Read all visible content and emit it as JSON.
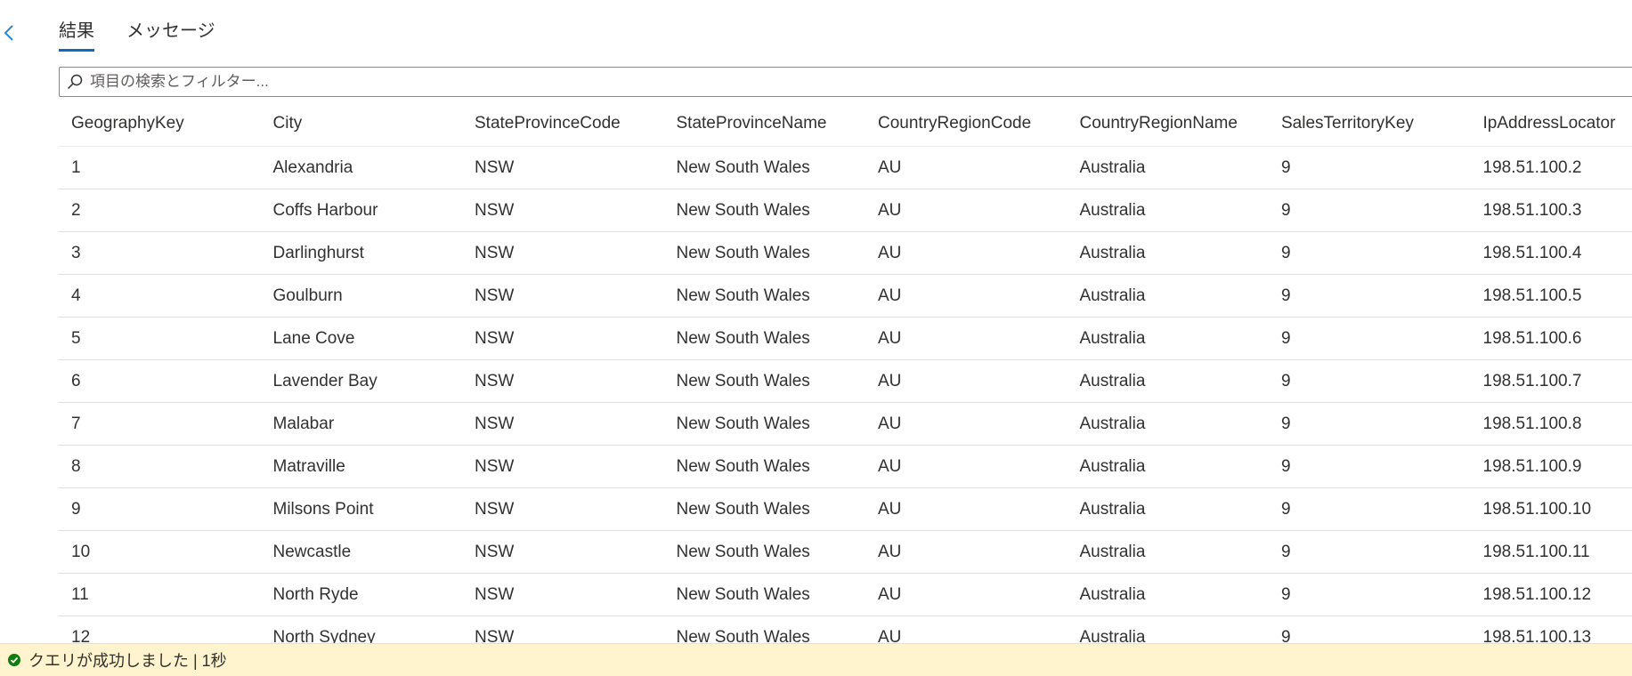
{
  "tabs": [
    {
      "label": "結果",
      "active": true
    },
    {
      "label": "メッセージ",
      "active": false
    }
  ],
  "search": {
    "placeholder": "項目の検索とフィルター...",
    "value": ""
  },
  "table": {
    "columns": [
      "GeographyKey",
      "City",
      "StateProvinceCode",
      "StateProvinceName",
      "CountryRegionCode",
      "CountryRegionName",
      "SalesTerritoryKey",
      "IpAddressLocator"
    ],
    "rows": [
      [
        "1",
        "Alexandria",
        "NSW",
        "New South Wales",
        "AU",
        "Australia",
        "9",
        "198.51.100.2"
      ],
      [
        "2",
        "Coffs Harbour",
        "NSW",
        "New South Wales",
        "AU",
        "Australia",
        "9",
        "198.51.100.3"
      ],
      [
        "3",
        "Darlinghurst",
        "NSW",
        "New South Wales",
        "AU",
        "Australia",
        "9",
        "198.51.100.4"
      ],
      [
        "4",
        "Goulburn",
        "NSW",
        "New South Wales",
        "AU",
        "Australia",
        "9",
        "198.51.100.5"
      ],
      [
        "5",
        "Lane Cove",
        "NSW",
        "New South Wales",
        "AU",
        "Australia",
        "9",
        "198.51.100.6"
      ],
      [
        "6",
        "Lavender Bay",
        "NSW",
        "New South Wales",
        "AU",
        "Australia",
        "9",
        "198.51.100.7"
      ],
      [
        "7",
        "Malabar",
        "NSW",
        "New South Wales",
        "AU",
        "Australia",
        "9",
        "198.51.100.8"
      ],
      [
        "8",
        "Matraville",
        "NSW",
        "New South Wales",
        "AU",
        "Australia",
        "9",
        "198.51.100.9"
      ],
      [
        "9",
        "Milsons Point",
        "NSW",
        "New South Wales",
        "AU",
        "Australia",
        "9",
        "198.51.100.10"
      ],
      [
        "10",
        "Newcastle",
        "NSW",
        "New South Wales",
        "AU",
        "Australia",
        "9",
        "198.51.100.11"
      ],
      [
        "11",
        "North Ryde",
        "NSW",
        "New South Wales",
        "AU",
        "Australia",
        "9",
        "198.51.100.12"
      ],
      [
        "12",
        "North Sydney",
        "NSW",
        "New South Wales",
        "AU",
        "Australia",
        "9",
        "198.51.100.13"
      ]
    ]
  },
  "status": {
    "text": "クエリが成功しました | 1秒"
  },
  "icons": {
    "back": "chevron-left-icon",
    "search": "search-icon",
    "status": "check-circle-icon"
  },
  "colors": {
    "accent": "#0f6cbd",
    "back_chevron": "#2b88d8",
    "status_background": "#fff4ce",
    "success": "#107c10"
  }
}
